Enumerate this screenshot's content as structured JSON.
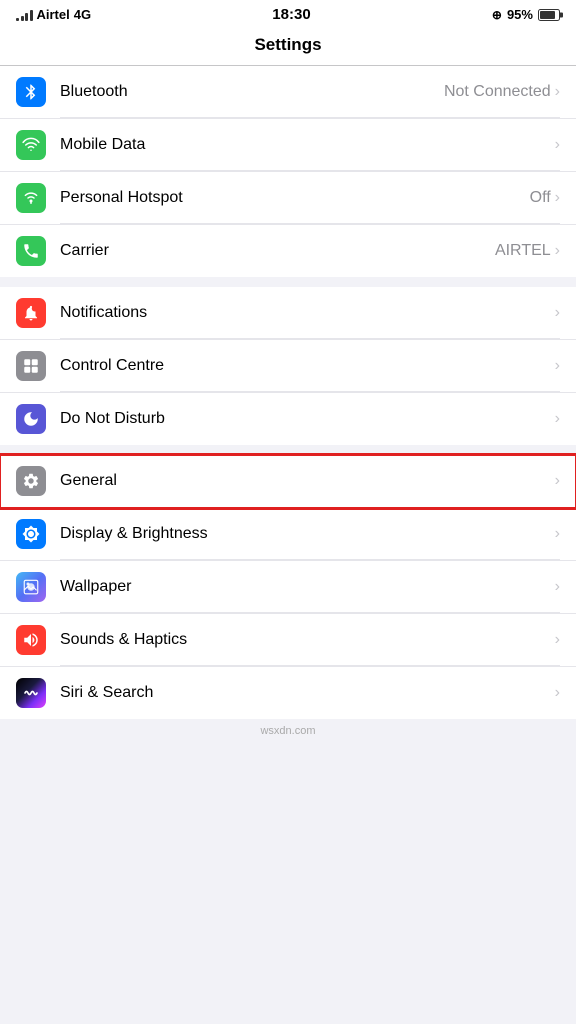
{
  "statusBar": {
    "carrier": "Airtel",
    "networkType": "4G",
    "time": "18:30",
    "locationIcon": "⊕",
    "batteryPercent": "95%"
  },
  "navBar": {
    "title": "Settings"
  },
  "sections": [
    {
      "id": "connectivity",
      "rows": [
        {
          "id": "bluetooth",
          "label": "Bluetooth",
          "iconColor": "blue",
          "iconType": "bluetooth",
          "valueText": "Not Connected",
          "showChevron": true,
          "partialTop": true
        },
        {
          "id": "mobile-data",
          "label": "Mobile Data",
          "iconColor": "green",
          "iconType": "mobile-data",
          "valueText": "",
          "showChevron": true
        },
        {
          "id": "personal-hotspot",
          "label": "Personal Hotspot",
          "iconColor": "teal-green",
          "iconType": "hotspot",
          "valueText": "Off",
          "showChevron": true
        },
        {
          "id": "carrier",
          "label": "Carrier",
          "iconColor": "green",
          "iconType": "carrier",
          "valueText": "AIRTEL",
          "showChevron": true
        }
      ]
    },
    {
      "id": "system",
      "rows": [
        {
          "id": "notifications",
          "label": "Notifications",
          "iconColor": "red",
          "iconType": "notifications",
          "valueText": "",
          "showChevron": true
        },
        {
          "id": "control-centre",
          "label": "Control Centre",
          "iconColor": "gray",
          "iconType": "control-centre",
          "valueText": "",
          "showChevron": true
        },
        {
          "id": "do-not-disturb",
          "label": "Do Not Disturb",
          "iconColor": "indigo",
          "iconType": "do-not-disturb",
          "valueText": "",
          "showChevron": true
        }
      ]
    },
    {
      "id": "general-group",
      "rows": [
        {
          "id": "general",
          "label": "General",
          "iconColor": "dark-gray",
          "iconType": "general",
          "valueText": "",
          "showChevron": true,
          "highlighted": true
        },
        {
          "id": "display-brightness",
          "label": "Display & Brightness",
          "iconColor": "blue",
          "iconType": "display",
          "valueText": "",
          "showChevron": true
        },
        {
          "id": "wallpaper",
          "label": "Wallpaper",
          "iconColor": "gradient-wallpaper",
          "iconType": "wallpaper",
          "valueText": "",
          "showChevron": true
        },
        {
          "id": "sounds-haptics",
          "label": "Sounds & Haptics",
          "iconColor": "red",
          "iconType": "sounds",
          "valueText": "",
          "showChevron": true
        },
        {
          "id": "siri-search",
          "label": "Siri & Search",
          "iconColor": "gradient-siri",
          "iconType": "siri",
          "valueText": "",
          "showChevron": true
        }
      ]
    }
  ],
  "watermark": "wsxdn.com"
}
